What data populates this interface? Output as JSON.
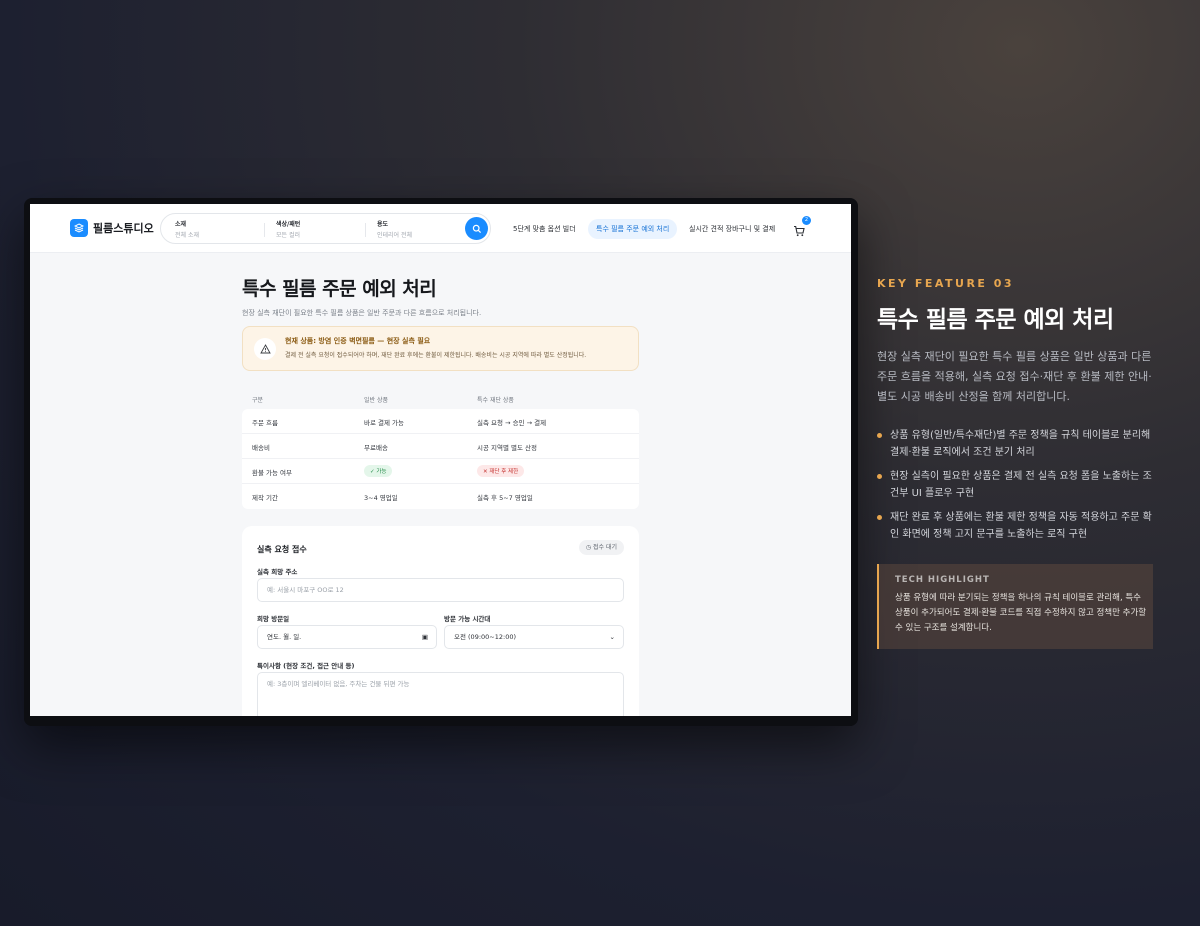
{
  "header": {
    "logo_text": "필름스튜디오",
    "search": {
      "material_label": "소재",
      "material_value": "전체 소재",
      "color_label": "색상/패턴",
      "color_value": "모든 컬러",
      "usage_label": "용도",
      "usage_value": "인테리어 전체"
    },
    "nav": [
      "5단계 맞춤 옵션 빌더",
      "특수 필름 주문 예외 처리",
      "실시간 견적 장바구니 및 결제"
    ],
    "cart_count": "2"
  },
  "page": {
    "title": "특수 필름 주문 예외 처리",
    "subtitle": "현장 실측 재단이 필요한 특수 필름 상품은 일반 주문과 다른 흐름으로 처리됩니다.",
    "alert": {
      "title": "현재 상품: 방염 인증 벽면필름 — 현장 실측 필요",
      "desc": "결제 전 실측 요청이 접수되어야 하며, 재단 완료 후에는 환불이 제한됩니다. 배송비는 시공 지역에 따라 별도 산정됩니다."
    },
    "table": {
      "headers": [
        "구분",
        "일반 상품",
        "특수 재단 상품"
      ],
      "rows": [
        [
          "주문 흐름",
          "바로 결제 가능",
          "실측 요청 → 승인 → 결제"
        ],
        [
          "배송비",
          "무료배송",
          "시공 지역별 별도 산정"
        ],
        [
          "환불 가능 여부",
          "✓ 가능",
          "✕ 재단 후 제한"
        ],
        [
          "제작 기간",
          "3~4 영업일",
          "실측 후 5~7 영업일"
        ]
      ]
    },
    "form": {
      "title": "실측 요청 접수",
      "status": "접수 대기",
      "address_label": "실측 희망 주소",
      "address_placeholder": "예: 서울시 마포구 OO로 12",
      "date_label": "희망 방문일",
      "date_placeholder": "연도. 월. 일.",
      "time_label": "방문 가능 시간대",
      "time_value": "오전 (09:00~12:00)",
      "notes_label": "특이사항 (현장 조건, 접근 안내 등)",
      "notes_placeholder": "예: 3층이며 엘리베이터 없음, 주차는 건물 뒤편 가능"
    }
  },
  "feature": {
    "tag": "KEY FEATURE 03",
    "title": "특수 필름 주문 예외 처리",
    "desc": "현장 실측 재단이 필요한 특수 필름 상품은 일반 상품과 다른 주문 흐름을 적용해, 실측 요청 접수·재단 후 환불 제한 안내·별도 시공 배송비 산정을 함께 처리합니다.",
    "bullets": [
      "상품 유형(일반/특수재단)별 주문 정책을 규칙 테이블로 분리해 결제·환불 로직에서 조건 분기 처리",
      "현장 실측이 필요한 상품은 결제 전 실측 요청 폼을 노출하는 조건부 UI 플로우 구현",
      "재단 완료 후 상품에는 환불 제한 정책을 자동 적용하고 주문 확인 화면에 정책 고지 문구를 노출하는 로직 구현"
    ],
    "tech_title": "TECH HIGHLIGHT",
    "tech_desc": "상품 유형에 따라 분기되는 정책을 하나의 규칙 테이블로 관리해, 특수 상품이 추가되어도 결제·환불 코드를 직접 수정하지 않고 정책만 추가할 수 있는 구조를 설계합니다."
  },
  "colors": {
    "accent": "#e7a64f",
    "brand_blue": "#1a8cff"
  }
}
